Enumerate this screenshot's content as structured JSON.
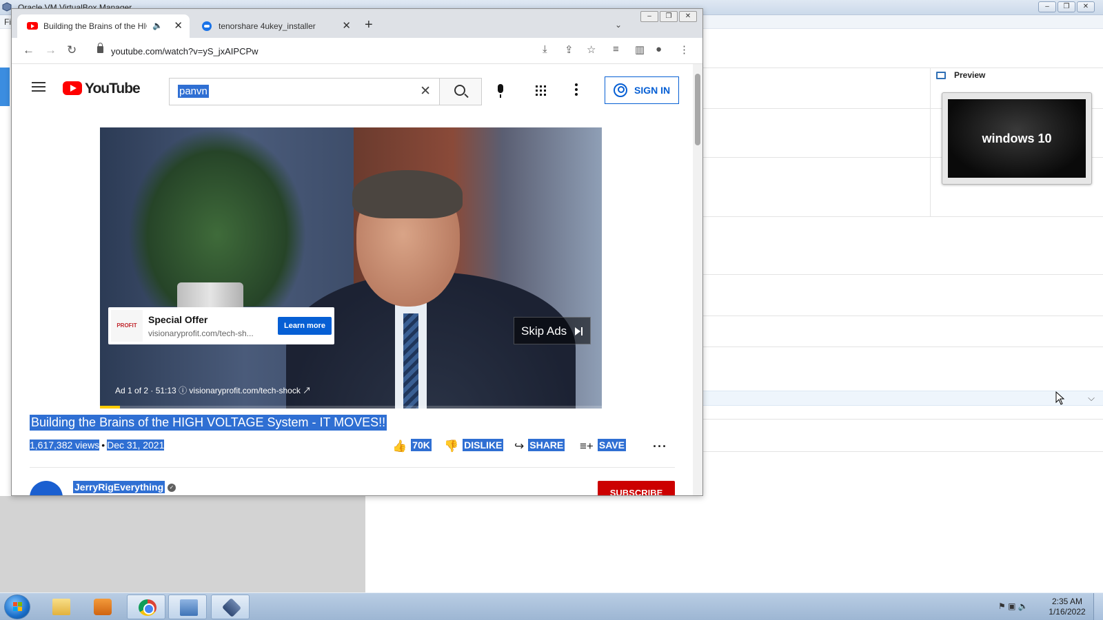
{
  "vbox": {
    "title": "Oracle VM VirtualBox Manager",
    "menu_partial": "Fi",
    "preview_label": "Preview",
    "vm_name": "windows 10"
  },
  "browser": {
    "tabs": [
      {
        "label": "Building the Brains of the HIGH VOLTAGE System - IT MOVES!!",
        "active": true
      },
      {
        "label": "tenorshare 4ukey_installer",
        "active": false
      }
    ],
    "url": "youtube.com/watch?v=yS_jxAIPCPw"
  },
  "youtube": {
    "logo_text": "YouTube",
    "search_query": "panvn",
    "sign_in_label": "SIGN IN",
    "ad": {
      "title": "Special Offer",
      "url": "visionaryprofit.com/tech-sh...",
      "logo_text": "PROFIT",
      "cta": "Learn more",
      "skip_label": "Skip Ads",
      "meta": "Ad 1 of 2 · 51:13",
      "meta_link": "visionaryprofit.com/tech-shock",
      "progress": 0.04
    },
    "video": {
      "title": "Building the Brains of the HIGH VOLTAGE System - IT MOVES!!",
      "views": "1,617,382 views",
      "date": "Dec 31, 2021",
      "likes": "70K",
      "dislike_label": "DISLIKE",
      "share_label": "SHARE",
      "save_label": "SAVE"
    },
    "channel": {
      "name": "JerryRigEverything",
      "subscribe_label": "SUBSCRIBE"
    }
  },
  "taskbar": {
    "time": "2:35 AM",
    "date": "1/16/2022"
  }
}
